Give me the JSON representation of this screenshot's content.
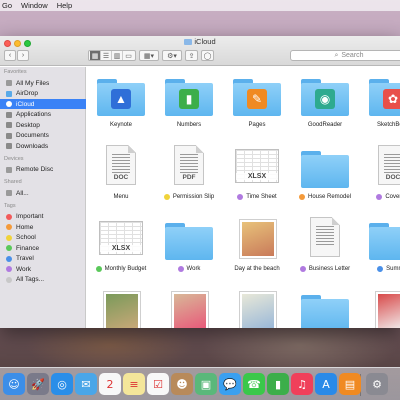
{
  "menubar": {
    "items": [
      "Go",
      "Window",
      "Help"
    ]
  },
  "window": {
    "title": "iCloud",
    "search_placeholder": "Search",
    "view_buttons": [
      "▦",
      "☰",
      "▥",
      "▭"
    ],
    "arrange_label": "▦▾",
    "action_label": "⚙▾",
    "share_label": "⇪",
    "tag_label": "◯"
  },
  "sidebar": {
    "favorites_header": "Favorites",
    "favorites": [
      {
        "label": "All My Files",
        "icon": "all-files-icon",
        "color": "#9a9a9a"
      },
      {
        "label": "AirDrop",
        "icon": "airdrop-icon",
        "color": "#59a9e8"
      },
      {
        "label": "iCloud",
        "icon": "cloud-icon",
        "color": "#ffffff"
      },
      {
        "label": "Applications",
        "icon": "applications-icon",
        "color": "#8a8a8a"
      },
      {
        "label": "Desktop",
        "icon": "desktop-icon",
        "color": "#8a8a8a"
      },
      {
        "label": "Documents",
        "icon": "documents-icon",
        "color": "#8a8a8a"
      },
      {
        "label": "Downloads",
        "icon": "downloads-icon",
        "color": "#8a8a8a"
      }
    ],
    "devices_header": "Devices",
    "devices": [
      {
        "label": "Remote Disc",
        "icon": "disc-icon",
        "color": "#9a9a9a"
      }
    ],
    "shared_header": "Shared",
    "shared": [
      {
        "label": "All...",
        "icon": "network-icon",
        "color": "#9a9a9a"
      }
    ],
    "tags_header": "Tags",
    "tags": [
      {
        "label": "Important",
        "color": "#f25a5a"
      },
      {
        "label": "Home",
        "color": "#f49a3a"
      },
      {
        "label": "School",
        "color": "#f0d33a"
      },
      {
        "label": "Finance",
        "color": "#5ac85a"
      },
      {
        "label": "Travel",
        "color": "#4a90e8"
      },
      {
        "label": "Work",
        "color": "#b07ae0"
      },
      {
        "label": "All Tags...",
        "color": "#c8c8c8"
      }
    ]
  },
  "files": [
    {
      "label": "Keynote",
      "kind": "folder",
      "glyph": "▲",
      "glyph_color": "#2f6fd8",
      "tag": ""
    },
    {
      "label": "Numbers",
      "kind": "folder",
      "glyph": "▮",
      "glyph_color": "#3cae4a",
      "tag": ""
    },
    {
      "label": "Pages",
      "kind": "folder",
      "glyph": "✎",
      "glyph_color": "#f08a22",
      "tag": ""
    },
    {
      "label": "GoodReader",
      "kind": "folder",
      "glyph": "◉",
      "glyph_color": "#2eaa8f",
      "tag": ""
    },
    {
      "label": "SketchBook",
      "kind": "folder",
      "glyph": "✿",
      "glyph_color": "#e8504a",
      "tag": ""
    },
    {
      "label": "Menu",
      "kind": "doc",
      "ext": "DOC",
      "tag": ""
    },
    {
      "label": "Permission Slip",
      "kind": "doc",
      "ext": "PDF",
      "tag": "#f0d33a"
    },
    {
      "label": "Time Sheet",
      "kind": "sheet",
      "ext": "XLSX",
      "tag": "#b07ae0"
    },
    {
      "label": "House Remodel",
      "kind": "folder",
      "glyph": "",
      "glyph_color": "",
      "tag": "#f49a3a"
    },
    {
      "label": "Cover Le",
      "kind": "doc",
      "ext": "DOC",
      "tag": "#b07ae0"
    },
    {
      "label": "Monthly Budget",
      "kind": "sheet",
      "ext": "XLSX",
      "tag": "#5ac85a"
    },
    {
      "label": "Work",
      "kind": "folder",
      "glyph": "",
      "glyph_color": "",
      "tag": "#b07ae0"
    },
    {
      "label": "Day at the beach",
      "kind": "photo",
      "photo_colors": [
        "#e8c27a",
        "#c97a5a"
      ],
      "tag": ""
    },
    {
      "label": "Business Letter",
      "kind": "doc",
      "ext": "",
      "tag": "#b07ae0"
    },
    {
      "label": "Summer",
      "kind": "folder",
      "glyph": "",
      "glyph_color": "",
      "tag": "#4a90e8"
    },
    {
      "label": "",
      "kind": "photo",
      "photo_colors": [
        "#7a9a5a",
        "#c8a878"
      ],
      "tag": ""
    },
    {
      "label": "",
      "kind": "photo",
      "photo_colors": [
        "#d8b898",
        "#e85a7a"
      ],
      "tag": ""
    },
    {
      "label": "",
      "kind": "photo",
      "photo_colors": [
        "#e8e8d8",
        "#9ab8d8"
      ],
      "tag": ""
    },
    {
      "label": "",
      "kind": "folder",
      "glyph": "",
      "glyph_color": "",
      "tag": ""
    },
    {
      "label": "",
      "kind": "photo",
      "photo_colors": [
        "#d84a4a",
        "#f2f2f2"
      ],
      "tag": ""
    }
  ],
  "dock": [
    {
      "name": "finder-dock-icon",
      "glyph": "☺",
      "color": "#3c8ee8"
    },
    {
      "name": "launchpad-dock-icon",
      "glyph": "🚀",
      "color": "#7a7a8a"
    },
    {
      "name": "safari-dock-icon",
      "glyph": "◎",
      "color": "#2a8ee8"
    },
    {
      "name": "mail-dock-icon",
      "glyph": "✉",
      "color": "#4aa6e8"
    },
    {
      "name": "calendar-dock-icon",
      "glyph": "2",
      "color": "#f8f8f8"
    },
    {
      "name": "notes-dock-icon",
      "glyph": "≡",
      "color": "#f4e69a"
    },
    {
      "name": "reminders-dock-icon",
      "glyph": "☑",
      "color": "#f8f8f8"
    },
    {
      "name": "contacts-dock-icon",
      "glyph": "☻",
      "color": "#b88a5a"
    },
    {
      "name": "photo-booth-dock-icon",
      "glyph": "▣",
      "color": "#5ab87a"
    },
    {
      "name": "messages-dock-icon",
      "glyph": "💬",
      "color": "#3aa0f0"
    },
    {
      "name": "facetime-dock-icon",
      "glyph": "☎",
      "color": "#3ac84a"
    },
    {
      "name": "numbers-dock-icon",
      "glyph": "▮",
      "color": "#3cae4a"
    },
    {
      "name": "itunes-dock-icon",
      "glyph": "♫",
      "color": "#f0405a"
    },
    {
      "name": "app-store-dock-icon",
      "glyph": "A",
      "color": "#2a8ae8"
    },
    {
      "name": "ibooks-dock-icon",
      "glyph": "▤",
      "color": "#f08a22"
    },
    {
      "name": "system-preferences-dock-icon",
      "glyph": "⚙",
      "color": "#8a8a92"
    }
  ]
}
